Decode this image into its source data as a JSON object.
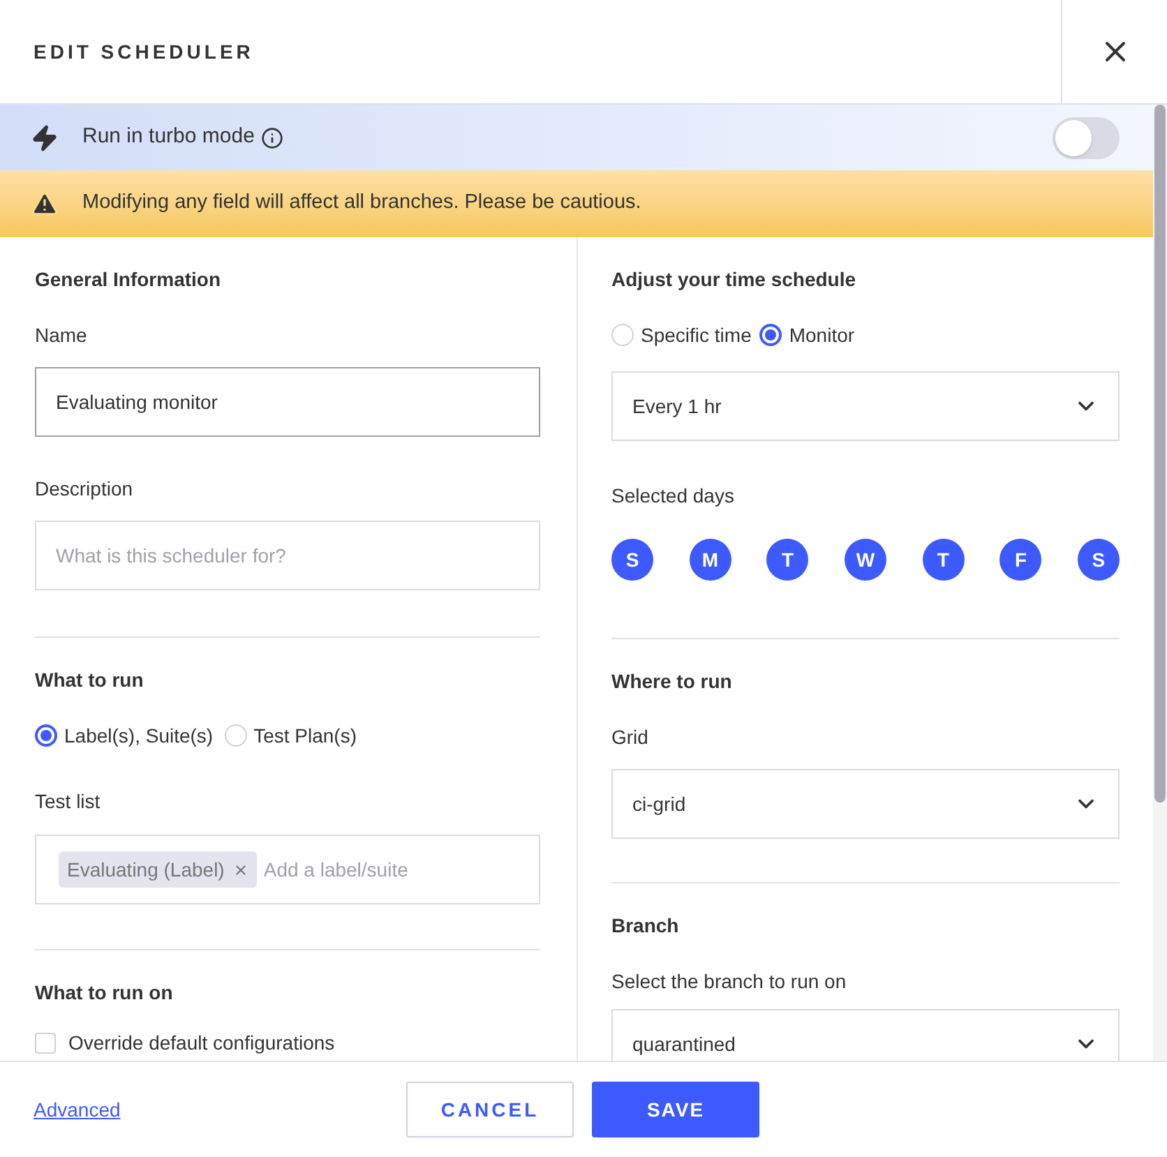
{
  "dialog": {
    "title": "EDIT SCHEDULER"
  },
  "turbo": {
    "label": "Run in turbo mode",
    "on": false
  },
  "warning": {
    "text": "Modifying any field will affect all branches. Please be cautious."
  },
  "general": {
    "heading": "General Information",
    "name_label": "Name",
    "name_value": "Evaluating monitor",
    "description_label": "Description",
    "description_placeholder": "What is this scheduler for?"
  },
  "what_to_run": {
    "heading": "What to run",
    "options": [
      {
        "label": "Label(s), Suite(s)",
        "selected": true
      },
      {
        "label": "Test Plan(s)",
        "selected": false
      }
    ],
    "test_list_label": "Test list",
    "tags": [
      {
        "label": "Evaluating (Label)"
      }
    ],
    "test_list_placeholder": "Add a label/suite"
  },
  "what_to_run_on": {
    "heading": "What to run on",
    "override": {
      "label": "Override default configurations",
      "checked": false
    }
  },
  "schedule": {
    "heading": "Adjust your time schedule",
    "options": [
      {
        "label": "Specific time",
        "selected": false
      },
      {
        "label": "Monitor",
        "selected": true
      }
    ],
    "frequency": "Every 1 hr",
    "days_label": "Selected days",
    "days": [
      {
        "label": "S",
        "selected": true
      },
      {
        "label": "M",
        "selected": true
      },
      {
        "label": "T",
        "selected": true
      },
      {
        "label": "W",
        "selected": true
      },
      {
        "label": "T",
        "selected": true
      },
      {
        "label": "F",
        "selected": true
      },
      {
        "label": "S",
        "selected": true
      }
    ]
  },
  "where_to_run": {
    "heading": "Where to run",
    "grid_label": "Grid",
    "grid_value": "ci-grid"
  },
  "branch": {
    "heading": "Branch",
    "label": "Select the branch to run on",
    "value": "quarantined"
  },
  "footer": {
    "advanced_link": "Advanced",
    "cancel": "CANCEL",
    "save": "SAVE"
  }
}
